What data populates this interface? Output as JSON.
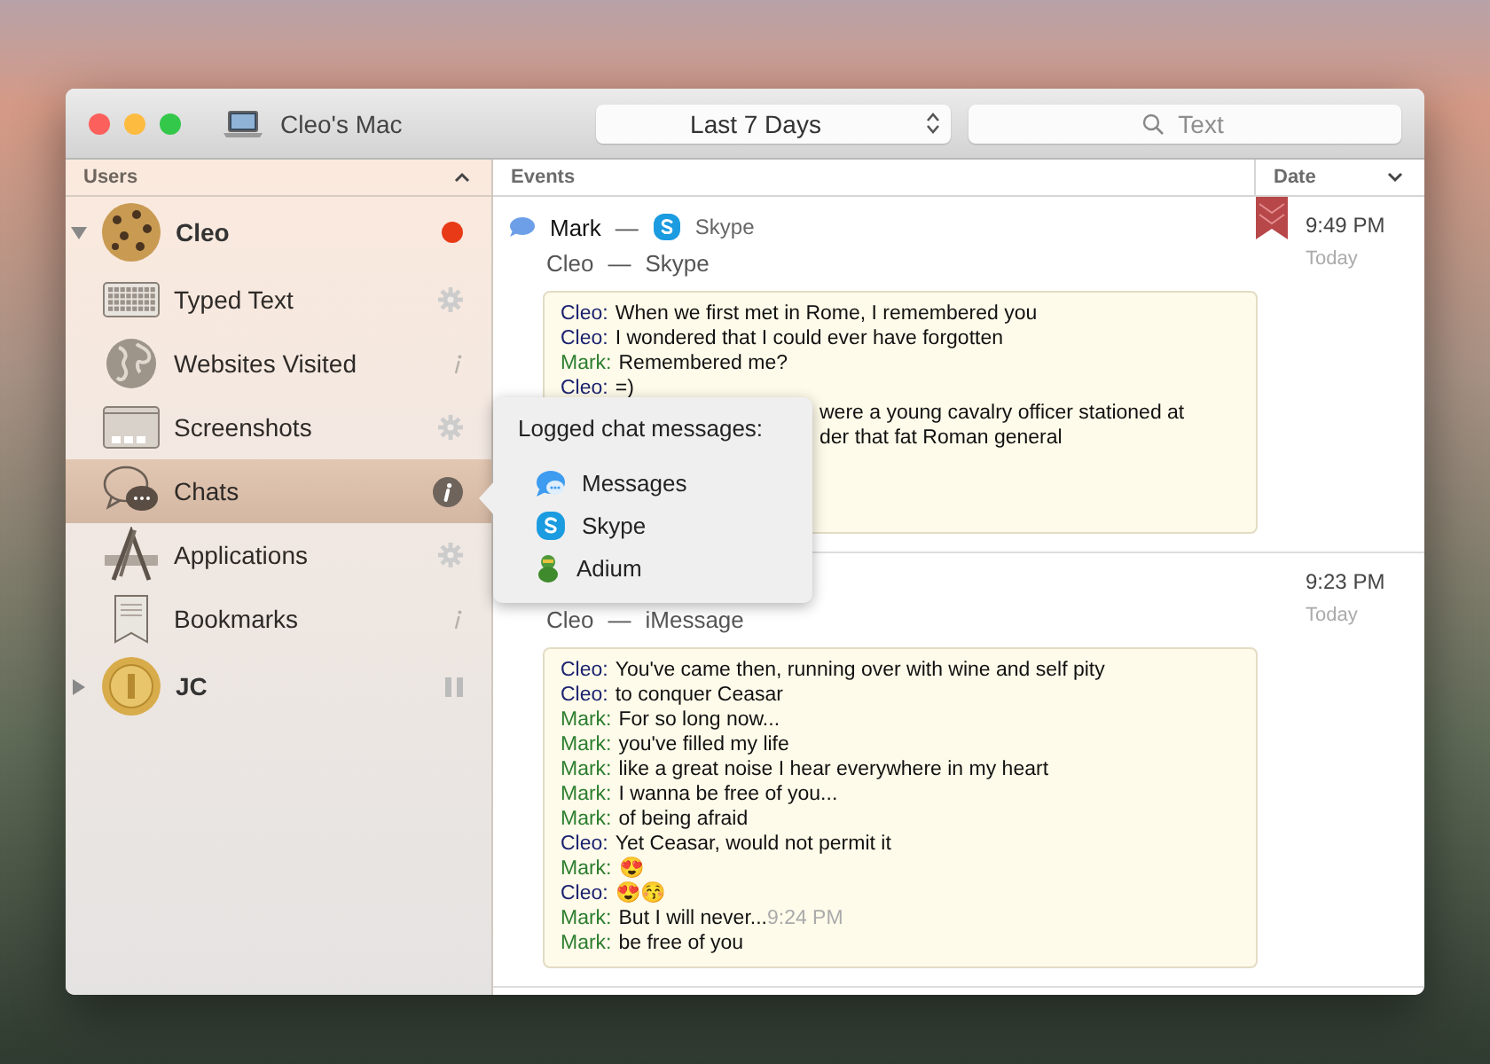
{
  "window": {
    "title": "Cleo's Mac",
    "date_range": "Last 7 Days",
    "search": {
      "placeholder": "Text"
    }
  },
  "sidebar": {
    "header": "Users",
    "users": [
      {
        "name": "Cleo",
        "recording": true,
        "expanded": true,
        "items": [
          {
            "label": "Typed Text",
            "kind": "keyboard",
            "selected": false
          },
          {
            "label": "Websites Visited",
            "kind": "globe",
            "selected": false
          },
          {
            "label": "Screenshots",
            "kind": "screen",
            "selected": false
          },
          {
            "label": "Chats",
            "kind": "chat",
            "selected": true
          },
          {
            "label": "Applications",
            "kind": "apps",
            "selected": false
          },
          {
            "label": "Bookmarks",
            "kind": "bookmark",
            "selected": false
          }
        ]
      },
      {
        "name": "JC",
        "recording": false,
        "expanded": false
      }
    ]
  },
  "table": {
    "columns": [
      "Events",
      "Date"
    ]
  },
  "events": [
    {
      "sender": {
        "name": "Mark",
        "separator": "—",
        "service": "Skype"
      },
      "recipient": {
        "name": "Cleo",
        "separator": "—",
        "service": "Skype"
      },
      "time": "9:49 PM",
      "day": "Today",
      "bookmarked": true,
      "lines": [
        {
          "speaker": "Cleo:",
          "color": "#1c2370",
          "text": "When we first met in Rome, I remembered you",
          "covered": false
        },
        {
          "speaker": "Cleo:",
          "color": "#1c2370",
          "text": "I wondered that I could ever have forgotten",
          "covered": false
        },
        {
          "speaker": "Mark:",
          "color": "#2b7d2e",
          "text": "Remembered me?",
          "covered": false
        },
        {
          "speaker": "Cleo:",
          "color": "#1c2370",
          "text": "=)",
          "covered": false
        },
        {
          "text": "were a young cavalry officer stationed at",
          "covered": true
        },
        {
          "text": "der that fat Roman general",
          "covered": true
        }
      ]
    },
    {
      "recipient": {
        "name": "Cleo",
        "separator": "—",
        "service": "iMessage"
      },
      "time": "9:23 PM",
      "day": "Today",
      "bookmarked": false,
      "lines": [
        {
          "speaker": "Cleo:",
          "color": "#1c2370",
          "text": "You've came then, running over with wine and self pity",
          "covered": false
        },
        {
          "speaker": "Cleo:",
          "color": "#1c2370",
          "text": "to conquer Ceasar",
          "covered": false
        },
        {
          "speaker": "Mark:",
          "color": "#2b7d2e",
          "text": "For so long now...",
          "covered": false
        },
        {
          "speaker": "Mark:",
          "color": "#2b7d2e",
          "text": "you've filled my life",
          "covered": false
        },
        {
          "speaker": "Mark:",
          "color": "#2b7d2e",
          "text": "like a great noise I hear everywhere in my heart",
          "covered": false
        },
        {
          "speaker": "Mark:",
          "color": "#2b7d2e",
          "text": "I wanna be free of you...",
          "covered": false
        },
        {
          "speaker": "Mark:",
          "color": "#2b7d2e",
          "text": "of being afraid",
          "covered": false
        },
        {
          "speaker": "Cleo:",
          "color": "#1c2370",
          "text": "Yet Ceasar, would not permit it",
          "covered": false
        },
        {
          "speaker": "Mark:",
          "color": "#2b7d2e",
          "text": "😍",
          "covered": false
        },
        {
          "speaker": "Cleo:",
          "color": "#1c2370",
          "text": "😍😚",
          "covered": false
        },
        {
          "speaker": "Mark:",
          "color": "#2b7d2e",
          "text": "But I will never...",
          "time": "9:24 PM",
          "covered": false
        },
        {
          "speaker": "Mark:",
          "color": "#2b7d2e",
          "text": "be free of you",
          "covered": false
        }
      ]
    }
  ],
  "popover": {
    "title": "Logged chat messages:",
    "apps": [
      {
        "name": "Messages",
        "kind": "messages"
      },
      {
        "name": "Skype",
        "kind": "skype"
      },
      {
        "name": "Adium",
        "kind": "adium"
      }
    ]
  }
}
